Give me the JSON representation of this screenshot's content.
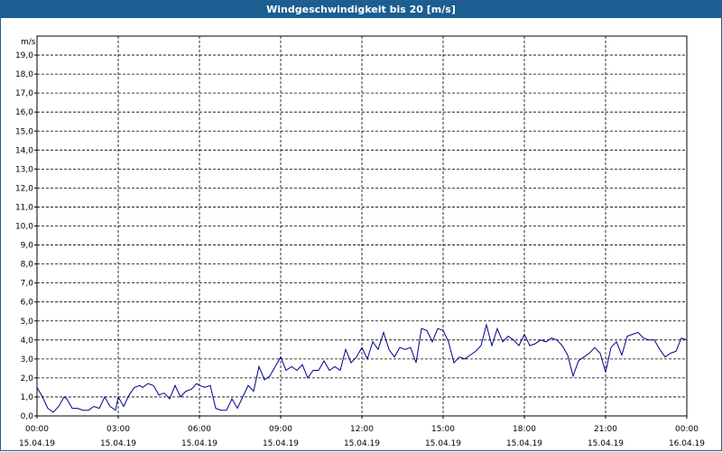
{
  "window": {
    "title": "Windgeschwindigkeit bis 20 [m/s]"
  },
  "chart_data": {
    "type": "line",
    "title": "Windgeschwindigkeit bis 20 [m/s]",
    "ylabel": "m/s",
    "xlabel": "",
    "ylim": [
      0,
      20
    ],
    "xlim_hours": [
      0,
      24
    ],
    "grid": true,
    "grid_style": "dashed",
    "line_color": "#00008b",
    "y_ticks": [
      "0,0",
      "1,0",
      "2,0",
      "3,0",
      "4,0",
      "5,0",
      "6,0",
      "7,0",
      "8,0",
      "9,0",
      "10,0",
      "11,0",
      "12,0",
      "13,0",
      "14,0",
      "15,0",
      "16,0",
      "17,0",
      "18,0",
      "19,0"
    ],
    "x_ticks": [
      {
        "time": "00:00",
        "date": "15.04.19"
      },
      {
        "time": "03:00",
        "date": "15.04.19"
      },
      {
        "time": "06:00",
        "date": "15.04.19"
      },
      {
        "time": "09:00",
        "date": "15.04.19"
      },
      {
        "time": "12:00",
        "date": "15.04.19"
      },
      {
        "time": "15:00",
        "date": "15.04.19"
      },
      {
        "time": "18:00",
        "date": "15.04.19"
      },
      {
        "time": "21:00",
        "date": "15.04.19"
      },
      {
        "time": "00:00",
        "date": "16.04.19"
      }
    ],
    "series": [
      {
        "x_hours": [
          0.0,
          0.2,
          0.4,
          0.6,
          0.8,
          1.0,
          1.1,
          1.3,
          1.5,
          1.7,
          1.9,
          2.1,
          2.3,
          2.5,
          2.7,
          2.9,
          3.0,
          3.2,
          3.4,
          3.6,
          3.8,
          3.9,
          4.1,
          4.3,
          4.5,
          4.7,
          4.9,
          5.1,
          5.3,
          5.5,
          5.7,
          5.9,
          6.0,
          6.2,
          6.4,
          6.6,
          6.8,
          7.0,
          7.2,
          7.4,
          7.6,
          7.8,
          8.0,
          8.2,
          8.4,
          8.6,
          8.8,
          9.0,
          9.2,
          9.4,
          9.6,
          9.8,
          10.0,
          10.2,
          10.4,
          10.6,
          10.8,
          11.0,
          11.2,
          11.4,
          11.6,
          11.8,
          12.0,
          12.2,
          12.4,
          12.6,
          12.8,
          13.0,
          13.2,
          13.4,
          13.6,
          13.8,
          14.0,
          14.2,
          14.4,
          14.6,
          14.8,
          15.0,
          15.2,
          15.4,
          15.6,
          15.8,
          16.0,
          16.2,
          16.4,
          16.6,
          16.8,
          17.0,
          17.2,
          17.4,
          17.6,
          17.8,
          18.0,
          18.2,
          18.4,
          18.6,
          18.8,
          19.0,
          19.2,
          19.4,
          19.6,
          19.8,
          20.0,
          20.2,
          20.4,
          20.6,
          20.8,
          21.0,
          21.2,
          21.4,
          21.6,
          21.8,
          22.0,
          22.2,
          22.4,
          22.6,
          22.8,
          23.0,
          23.2,
          23.4,
          23.6,
          23.8,
          24.0
        ],
        "values": [
          1.5,
          1.0,
          0.4,
          0.2,
          0.5,
          1.0,
          0.9,
          0.4,
          0.4,
          0.3,
          0.3,
          0.5,
          0.4,
          1.0,
          0.5,
          0.3,
          1.0,
          0.5,
          1.1,
          1.5,
          1.6,
          1.5,
          1.7,
          1.6,
          1.1,
          1.2,
          0.9,
          1.6,
          1.0,
          1.3,
          1.4,
          1.7,
          1.6,
          1.5,
          1.6,
          0.4,
          0.3,
          0.3,
          0.9,
          0.4,
          1.0,
          1.6,
          1.3,
          2.6,
          1.9,
          2.1,
          2.6,
          3.1,
          2.4,
          2.6,
          2.4,
          2.7,
          2.0,
          2.4,
          2.4,
          2.9,
          2.4,
          2.6,
          2.4,
          3.5,
          2.8,
          3.1,
          3.6,
          3.0,
          3.9,
          3.5,
          4.4,
          3.5,
          3.1,
          3.6,
          3.5,
          3.6,
          2.8,
          4.6,
          4.5,
          3.9,
          4.6,
          4.5,
          3.9,
          2.8,
          3.1,
          3.0,
          3.2,
          3.4,
          3.7,
          4.8,
          3.7,
          4.6,
          3.9,
          4.2,
          4.0,
          3.7,
          4.3,
          3.7,
          3.8,
          4.0,
          3.9,
          4.1,
          4.0,
          3.7,
          3.2,
          2.1,
          2.9,
          3.1,
          3.3,
          3.6,
          3.3,
          2.3,
          3.6,
          3.9,
          3.2,
          4.2,
          4.3,
          4.4,
          4.1,
          4.0,
          4.0,
          3.5,
          3.1,
          3.3,
          3.4,
          4.1,
          4.0
        ]
      }
    ]
  }
}
